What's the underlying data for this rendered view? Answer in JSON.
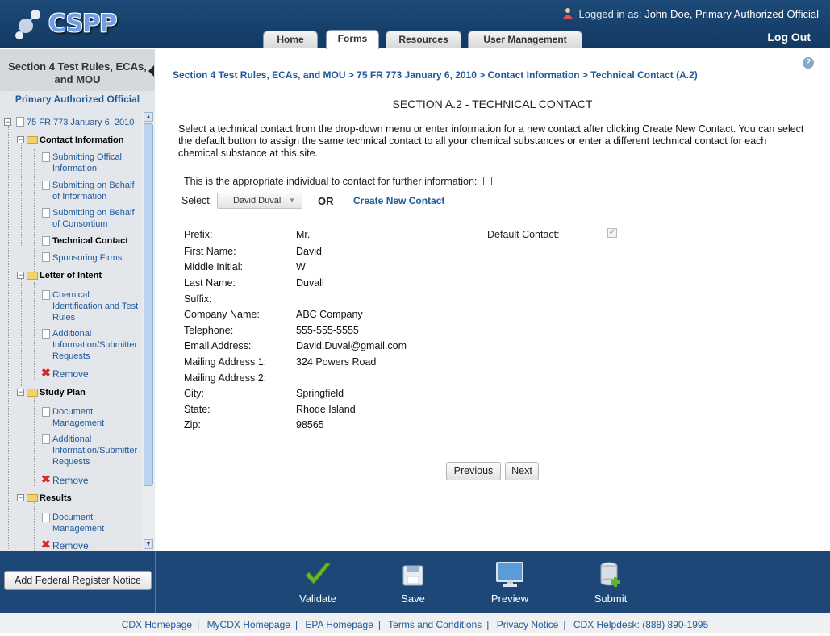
{
  "header": {
    "logo_text": "CSPP",
    "logged_in_label": "Logged in as:",
    "user": "John Doe, Primary Authorized Official",
    "logout": "Log Out",
    "tabs": [
      {
        "label": "Home"
      },
      {
        "label": "Forms",
        "active": true
      },
      {
        "label": "Resources"
      },
      {
        "label": "User Management"
      }
    ]
  },
  "sidebar": {
    "title_line1": "Section 4 Test Rules, ECAs,",
    "title_line2": "and MOU",
    "role": "Primary Authorized Official",
    "tree": {
      "root": "75 FR 773 January 6, 2010",
      "contact_info": "Contact Information",
      "submitting_official_1": "Submitting Offical",
      "submitting_official_2": "Information",
      "behalf_info_1": "Submitting on Behalf",
      "behalf_info_2": "of Information",
      "behalf_consortium_1": "Submitting on Behalf",
      "behalf_consortium_2": "of Consortium",
      "technical_contact": "Technical Contact",
      "sponsoring_firms": "Sponsoring Firms",
      "letter_of_intent": "Letter of Intent",
      "chem_id_1": "Chemical",
      "chem_id_2": "Identification and Test",
      "chem_id_3": "Rules",
      "addl_info_1": "Additional",
      "addl_info_2": "Information/Submitter",
      "addl_info_3": "Requests",
      "remove": "Remove",
      "study_plan": "Study Plan",
      "doc_mgmt_1": "Document",
      "doc_mgmt_2": "Management",
      "results": "Results"
    }
  },
  "main": {
    "breadcrumb": "Section 4 Test Rules, ECAs, and MOU > 75 FR 773 January 6, 2010 > Contact Information > Technical Contact (A.2)",
    "title": "SECTION A.2 - TECHNICAL CONTACT",
    "intro": "Select a technical contact from the drop-down menu or enter information for a new contact after clicking Create New Contact. You can select the default button to assign the same technical contact to all your chemical substances or enter a different technical contact for each chemical substance at this site.",
    "appropriate_label": "This is the appropriate individual to contact for further information:",
    "select_label": "Select:",
    "select_value": "David Duvall",
    "or_label": "OR",
    "create_new": "Create New Contact",
    "default_contact_label": "Default Contact:",
    "fields": {
      "prefix": {
        "label": "Prefix:",
        "value": "Mr."
      },
      "first_name": {
        "label": "First Name:",
        "value": "David"
      },
      "middle_initial": {
        "label": "Middle Initial:",
        "value": "W"
      },
      "last_name": {
        "label": "Last Name:",
        "value": "Duvall"
      },
      "suffix": {
        "label": "Suffix:",
        "value": ""
      },
      "company": {
        "label": "Company Name:",
        "value": "ABC Company"
      },
      "telephone": {
        "label": "Telephone:",
        "value": "555-555-5555"
      },
      "email": {
        "label": "Email Address:",
        "value": "David.Duval@gmail.com"
      },
      "mailing1": {
        "label": "Mailing Address 1:",
        "value": "324 Powers Road"
      },
      "mailing2": {
        "label": "Mailing Address 2:",
        "value": ""
      },
      "city": {
        "label": "City:",
        "value": "Springfield"
      },
      "state": {
        "label": "State:",
        "value": "Rhode Island"
      },
      "zip": {
        "label": "Zip:",
        "value": "98565"
      }
    },
    "previous": "Previous",
    "next": "Next"
  },
  "toolbar": {
    "add_frn": "Add Federal Register Notice",
    "validate": "Validate",
    "save": "Save",
    "preview": "Preview",
    "submit": "Submit"
  },
  "footer": {
    "links": [
      "CDX Homepage",
      "MyCDX Homepage",
      "EPA Homepage",
      "Terms and Conditions",
      "Privacy Notice",
      "CDX Helpdesk: (888) 890-1995"
    ]
  },
  "colors": {
    "header_bg": "#1d4a78",
    "link": "#1f5a9a",
    "remove": "#d42a2a",
    "validate_check": "#6db52b"
  }
}
